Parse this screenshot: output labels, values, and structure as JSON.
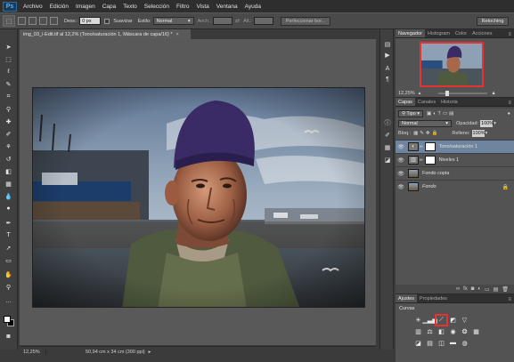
{
  "menubar": {
    "logo": "Ps",
    "items": [
      "Archivo",
      "Edición",
      "Imagen",
      "Capa",
      "Texto",
      "Selección",
      "Filtro",
      "Vista",
      "Ventana",
      "Ayuda"
    ]
  },
  "options": {
    "feather_label": "Desv.:",
    "feather_value": "0 px",
    "antialias_label": "Suavizar",
    "style_label": "Estilo:",
    "style_value": "Normal",
    "width_label": "Anch.:",
    "height_label": "Alt.:",
    "refine_button": "Perfeccionar bor...",
    "workspace": "Retoching"
  },
  "document": {
    "tab_title": "img_03_i-Edit.tif al 12,2% (Tono/saturación 1, Máscara de capa/16) *",
    "close": "×"
  },
  "status": {
    "zoom": "12,25%",
    "info": "50,94 cm x 34 cm (300 ppi)"
  },
  "navigator": {
    "tabs": [
      "Navegador",
      "Histogram",
      "Color",
      "Acciones"
    ],
    "zoom": "12,25%"
  },
  "layers_panel": {
    "tabs": [
      "Capas",
      "Canales",
      "Historia"
    ],
    "kind": "Tipo",
    "blend_mode": "Normal",
    "opacity_label": "Opacidad:",
    "opacity_value": "100%",
    "lock_label": "Bloq.:",
    "fill_label": "Relleno:",
    "fill_value": "100%",
    "layers": [
      {
        "name": "Tono/saturación 1",
        "selected": true
      },
      {
        "name": "Niveles 1",
        "selected": false
      },
      {
        "name": "Fondo copia",
        "selected": false
      },
      {
        "name": "Fondo",
        "selected": false
      }
    ]
  },
  "adjustments": {
    "tabs": [
      "Ajustes",
      "Propiedades"
    ],
    "hover_label": "Curvas"
  },
  "colors": {
    "highlight": "#e53333",
    "selected_layer": "#6f849e"
  }
}
